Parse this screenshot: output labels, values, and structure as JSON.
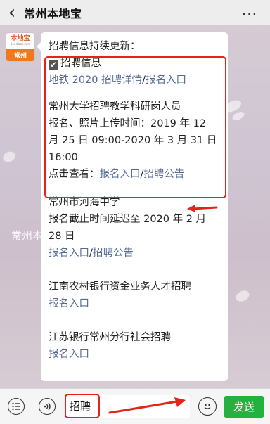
{
  "header": {
    "back_icon": "chevron-left-icon",
    "title": "常州本地宝",
    "more_icon": "more-dots-icon"
  },
  "avatar": {
    "logo_text": "本地宝",
    "logo_url": "Bendibao.com",
    "city_label": "常州"
  },
  "background": {
    "watermark": "常州本地宝"
  },
  "message": {
    "intro": "招聘信息持续更新：",
    "section_title": "招聘信息",
    "metro_text": "地铁 2020 招聘详情",
    "metro_sep": "/",
    "metro_signup": "报名入口",
    "cczu_title": "常州大学招聘教学科研岗人员",
    "cczu_line2": "报名、照片上传时间：2019 年 12",
    "cczu_line3": "月 25 日 09:00-2020 年 3 月 31 日",
    "cczu_line4": "16:00",
    "cczu_prefix": "点击查看：",
    "cczu_signup": "报名入口",
    "cczu_sep": "/",
    "cczu_notice": "招聘公告",
    "hhu_title": "常州市河海中学",
    "hhu_line2": "报名截止时间延迟至 2020 年 2 月",
    "hhu_line3": "28 日",
    "hhu_signup": "报名入口",
    "hhu_sep": "/",
    "hhu_notice": "招聘公告",
    "rural_title": "江南农村银行资金业务人才招聘",
    "rural_signup": "报名入口",
    "jsbank_title": "江苏银行常州分行社会招聘",
    "jsbank_signup": "报名入口"
  },
  "input_bar": {
    "menu_icon": "list-menu-icon",
    "voice_icon": "voice-icon",
    "input_value": "招聘",
    "emoji_icon": "emoji-icon",
    "send_label": "发送"
  },
  "colors": {
    "link": "#566a96",
    "highlight": "#e8211a",
    "send": "#24b13f",
    "brand": "#f07a1a"
  }
}
